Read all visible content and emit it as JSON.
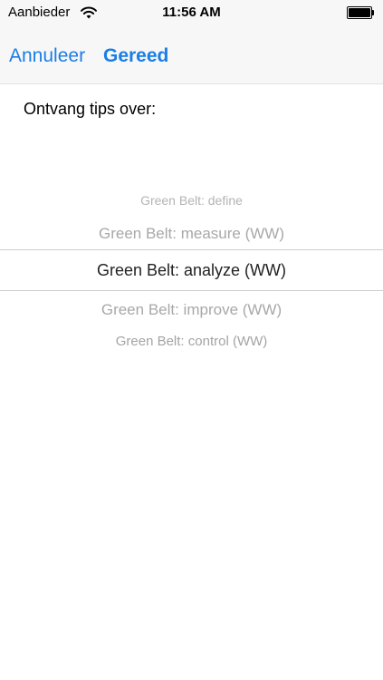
{
  "status_bar": {
    "carrier": "Aanbieder",
    "time": "11:56 AM",
    "wifi_icon": "wifi-icon",
    "battery_icon": "battery-icon",
    "battery_level": 1.0
  },
  "navbar": {
    "cancel_label": "Annuleer",
    "done_label": "Gereed",
    "accent_color": "#1a7ee6"
  },
  "content": {
    "label": "Ontvang tips over:"
  },
  "picker": {
    "options": [
      "Green Belt: define",
      "Green Belt: measure (WW)",
      "Green Belt: analyze (WW)",
      "Green Belt: improve (WW)",
      "Green Belt: control (WW)"
    ],
    "selected": "Green Belt: analyze (WW)"
  }
}
